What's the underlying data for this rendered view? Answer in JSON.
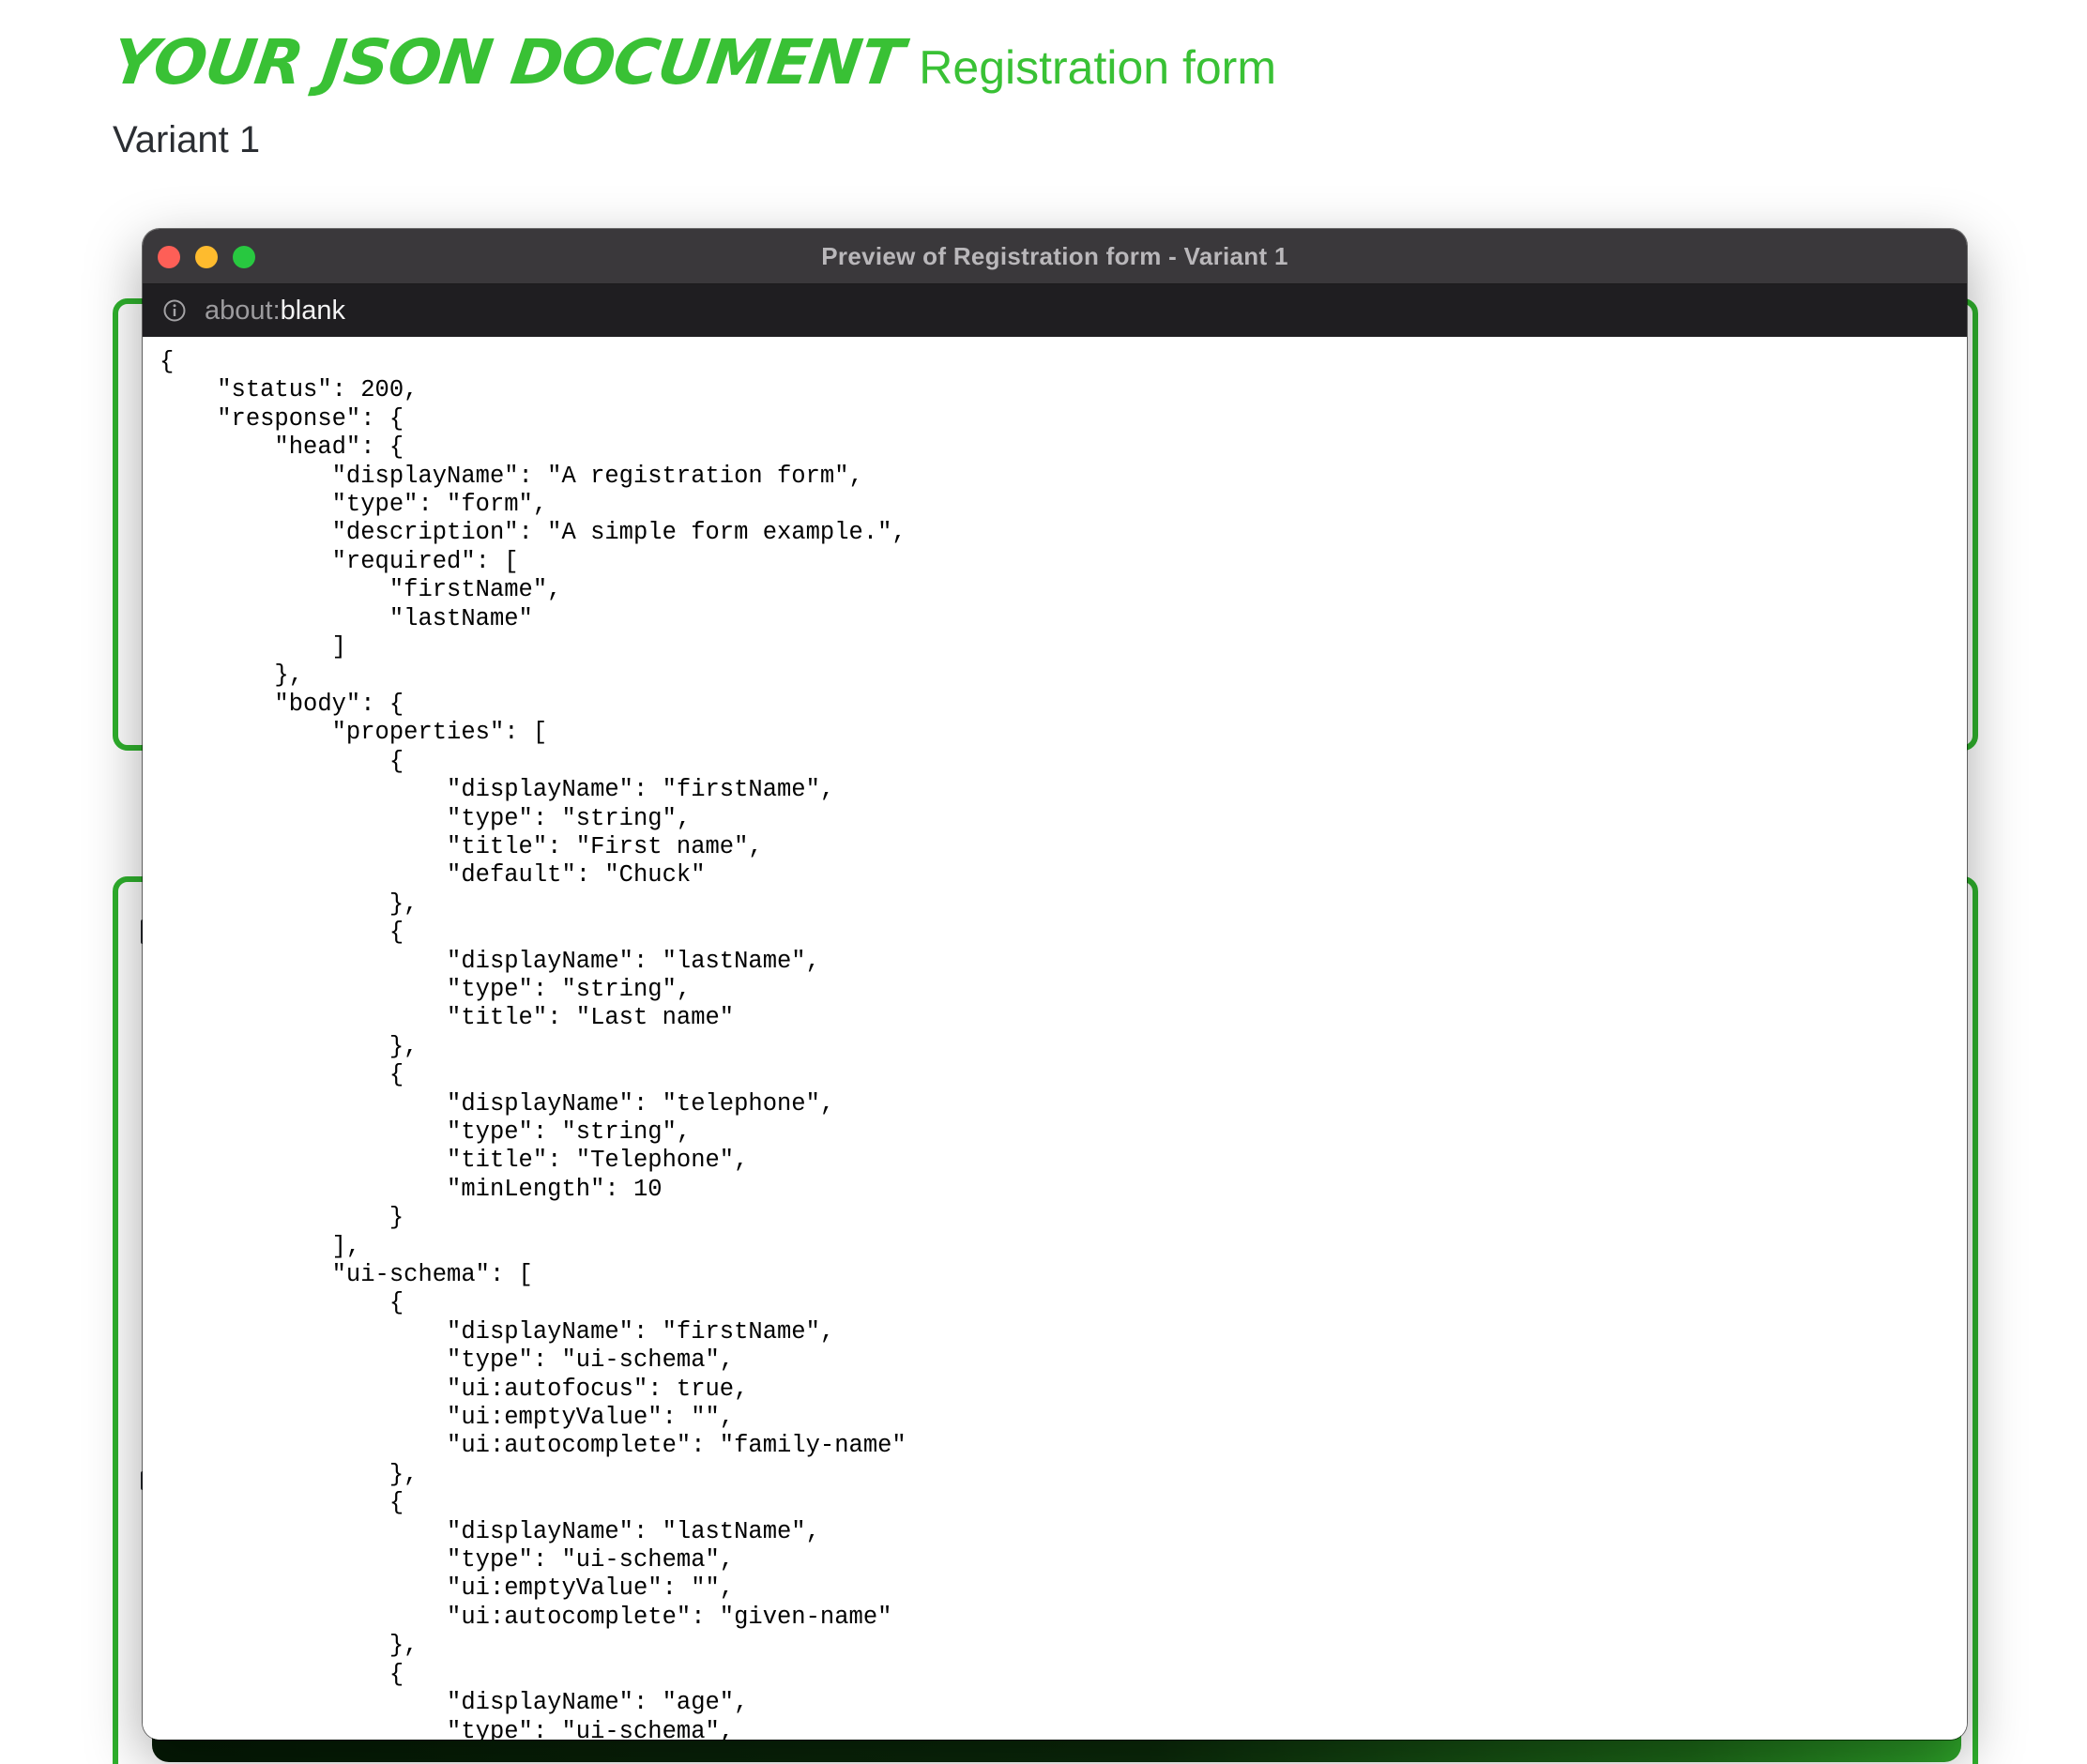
{
  "header": {
    "brand_title": "Your JSON Document",
    "document_name": "Registration form",
    "variant": "Variant 1"
  },
  "window": {
    "title": "Preview of Registration form - Variant 1",
    "url_scheme": "about:",
    "url_rest": "blank"
  },
  "json_text": "{\n    \"status\": 200,\n    \"response\": {\n        \"head\": {\n            \"displayName\": \"A registration form\",\n            \"type\": \"form\",\n            \"description\": \"A simple form example.\",\n            \"required\": [\n                \"firstName\",\n                \"lastName\"\n            ]\n        },\n        \"body\": {\n            \"properties\": [\n                {\n                    \"displayName\": \"firstName\",\n                    \"type\": \"string\",\n                    \"title\": \"First name\",\n                    \"default\": \"Chuck\"\n                },\n                {\n                    \"displayName\": \"lastName\",\n                    \"type\": \"string\",\n                    \"title\": \"Last name\"\n                },\n                {\n                    \"displayName\": \"telephone\",\n                    \"type\": \"string\",\n                    \"title\": \"Telephone\",\n                    \"minLength\": 10\n                }\n            ],\n            \"ui-schema\": [\n                {\n                    \"displayName\": \"firstName\",\n                    \"type\": \"ui-schema\",\n                    \"ui:autofocus\": true,\n                    \"ui:emptyValue\": \"\",\n                    \"ui:autocomplete\": \"family-name\"\n                },\n                {\n                    \"displayName\": \"lastName\",\n                    \"type\": \"ui-schema\",\n                    \"ui:emptyValue\": \"\",\n                    \"ui:autocomplete\": \"given-name\"\n                },\n                {\n                    \"displayName\": \"age\",\n                    \"type\": \"ui-schema\",",
  "colors": {
    "accent_green": "#39c135",
    "card_border_green": "#2fb12d",
    "titlebar": "#3a383b",
    "addressbar": "#1f1e21",
    "traffic_close": "#fe5f57",
    "traffic_minimize": "#febb2e",
    "traffic_zoom": "#28c840"
  },
  "icons": {
    "address_info": "info-circle-icon"
  }
}
